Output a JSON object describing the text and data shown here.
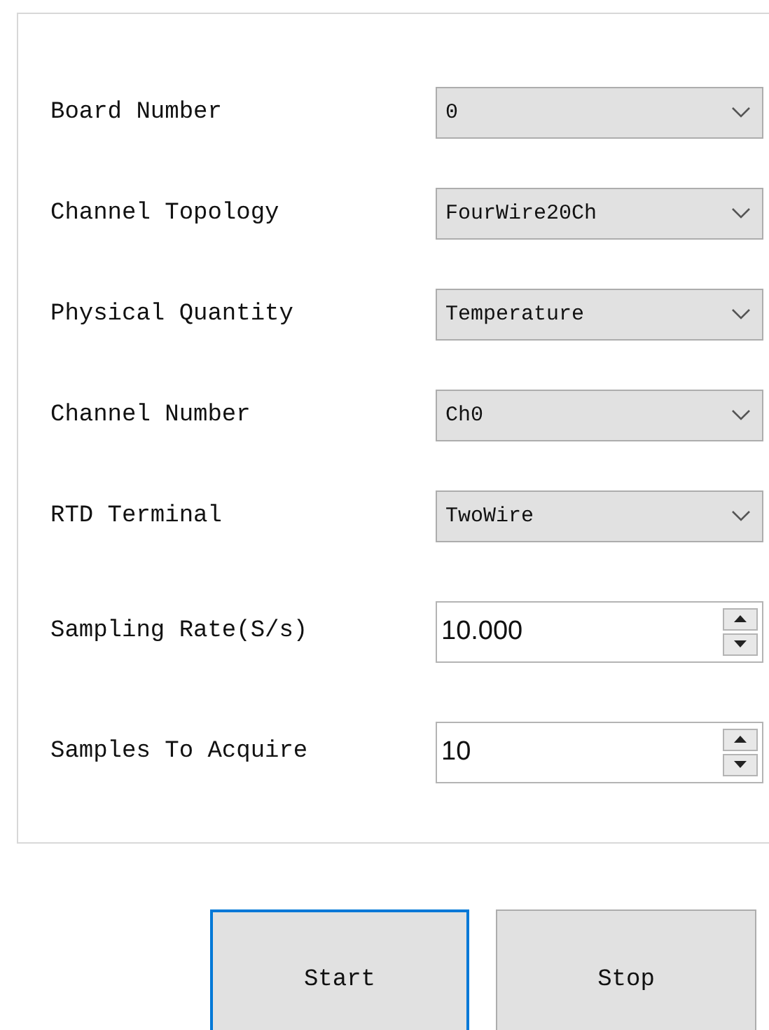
{
  "settings": [
    {
      "kind": "dropdown",
      "label": "Board Number",
      "value": "0"
    },
    {
      "kind": "dropdown",
      "label": "Channel Topology",
      "value": "FourWire20Ch"
    },
    {
      "kind": "dropdown",
      "label": "Physical Quantity",
      "value": "Temperature"
    },
    {
      "kind": "dropdown",
      "label": "Channel Number",
      "value": "Ch0"
    },
    {
      "kind": "dropdown",
      "label": "RTD Terminal",
      "value": "TwoWire"
    },
    {
      "kind": "spinner",
      "label": "Sampling Rate(S/s)",
      "value": "10.000"
    },
    {
      "kind": "spinner",
      "label": "Samples To Acquire",
      "value": "10"
    }
  ],
  "buttons": [
    {
      "label": "Start",
      "focused": true
    },
    {
      "label": "Stop",
      "focused": false
    }
  ]
}
